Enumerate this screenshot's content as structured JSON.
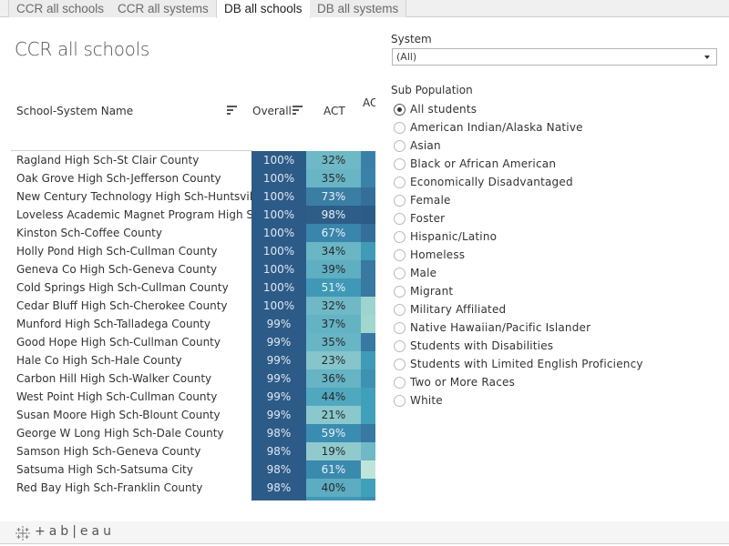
{
  "tabs": [
    {
      "label": "CCR all schools",
      "active": false
    },
    {
      "label": "CCR all systems",
      "active": false
    },
    {
      "label": "DB all schools",
      "active": true
    },
    {
      "label": "DB all systems",
      "active": false
    }
  ],
  "page_title": "CCR all schools",
  "table": {
    "columns": {
      "name": "School-System Name",
      "overall": "Overall",
      "act": "ACT",
      "third_partial": "AC"
    },
    "rows": [
      {
        "name": "Ragland High Sch-St Clair County",
        "overall": "100%",
        "act": "32%",
        "act_color": "#6fb8c6",
        "third_color": "#3a80a6"
      },
      {
        "name": "Oak Grove High Sch-Jefferson County",
        "overall": "100%",
        "act": "35%",
        "act_color": "#68b5c5",
        "third_color": "#3a82a8"
      },
      {
        "name": "New Century Technology High Sch-Huntsvill..",
        "overall": "100%",
        "act": "73%",
        "act_color": "#3a7ea4",
        "third_color": "#346f99"
      },
      {
        "name": "Loveless Academic Magnet Program High Sc-..",
        "overall": "100%",
        "act": "98%",
        "act_color": "#2e5d88",
        "third_color": "#2d5b87"
      },
      {
        "name": "Kinston Sch-Coffee County",
        "overall": "100%",
        "act": "67%",
        "act_color": "#3985ab",
        "third_color": "#346f99"
      },
      {
        "name": "Holly Pond High Sch-Cullman County",
        "overall": "100%",
        "act": "34%",
        "act_color": "#6ab6c5",
        "third_color": "#3f9bb7"
      },
      {
        "name": "Geneva Co High Sch-Geneva County",
        "overall": "100%",
        "act": "39%",
        "act_color": "#5eafc2",
        "third_color": "#3878a1"
      },
      {
        "name": "Cold Springs High Sch-Cullman County",
        "overall": "100%",
        "act": "51%",
        "act_color": "#3f98b6",
        "third_color": "#3878a1"
      },
      {
        "name": "Cedar Bluff High Sch-Cherokee County",
        "overall": "100%",
        "act": "32%",
        "act_color": "#6fb8c6",
        "third_color": "#9dd4cf"
      },
      {
        "name": "Munford High Sch-Talladega County",
        "overall": "99%",
        "act": "37%",
        "act_color": "#64b3c4",
        "third_color": "#a2d7d0"
      },
      {
        "name": "Good Hope High Sch-Cullman County",
        "overall": "99%",
        "act": "35%",
        "act_color": "#68b5c5",
        "third_color": "#3878a1"
      },
      {
        "name": "Hale Co High Sch-Hale County",
        "overall": "99%",
        "act": "23%",
        "act_color": "#86c5cc",
        "third_color": "#3f9bb7"
      },
      {
        "name": "Carbon Hill High Sch-Walker County",
        "overall": "99%",
        "act": "36%",
        "act_color": "#66b4c4",
        "third_color": "#3d92b2"
      },
      {
        "name": "West Point High Sch-Cullman County",
        "overall": "99%",
        "act": "44%",
        "act_color": "#50a8bf",
        "third_color": "#40a0b9"
      },
      {
        "name": "Susan Moore High Sch-Blount County",
        "overall": "99%",
        "act": "21%",
        "act_color": "#8bc8cd",
        "third_color": "#40a0b9"
      },
      {
        "name": "George W Long High Sch-Dale County",
        "overall": "98%",
        "act": "59%",
        "act_color": "#3a8db0",
        "third_color": "#3878a1"
      },
      {
        "name": "Samson High Sch-Geneva County",
        "overall": "98%",
        "act": "19%",
        "act_color": "#90cacd",
        "third_color": "#6fb8c6"
      },
      {
        "name": "Satsuma High Sch-Satsuma City",
        "overall": "98%",
        "act": "61%",
        "act_color": "#3a8aae",
        "third_color": "#bfe4d9"
      },
      {
        "name": "Red Bay High Sch-Franklin County",
        "overall": "98%",
        "act": "40%",
        "act_color": "#5cadc1",
        "third_color": "#40a0b9"
      }
    ]
  },
  "colors": {
    "overall_cell": "#2d5b87",
    "dark_text_threshold": 45,
    "light_cell_text": "#e8f1f6",
    "dark_cell_text": "#2a2a2a"
  },
  "filters": {
    "system": {
      "label": "System",
      "value": "(All)"
    },
    "sub_population": {
      "label": "Sub Population",
      "selected": "All students",
      "options": [
        "All students",
        "American Indian/Alaska Native",
        "Asian",
        "Black or African American",
        "Economically Disadvantaged",
        "Female",
        "Foster",
        "Hispanic/Latino",
        "Homeless",
        "Male",
        "Migrant",
        "Military Affiliated",
        "Native Hawaiian/Pacific Islander",
        "Students with Disabilities",
        "Students with Limited English Proficiency",
        "Two or More Races",
        "White"
      ]
    }
  },
  "footer": {
    "logo_icon": "tableau-logo-icon",
    "logo_text": "+ab|eau"
  }
}
